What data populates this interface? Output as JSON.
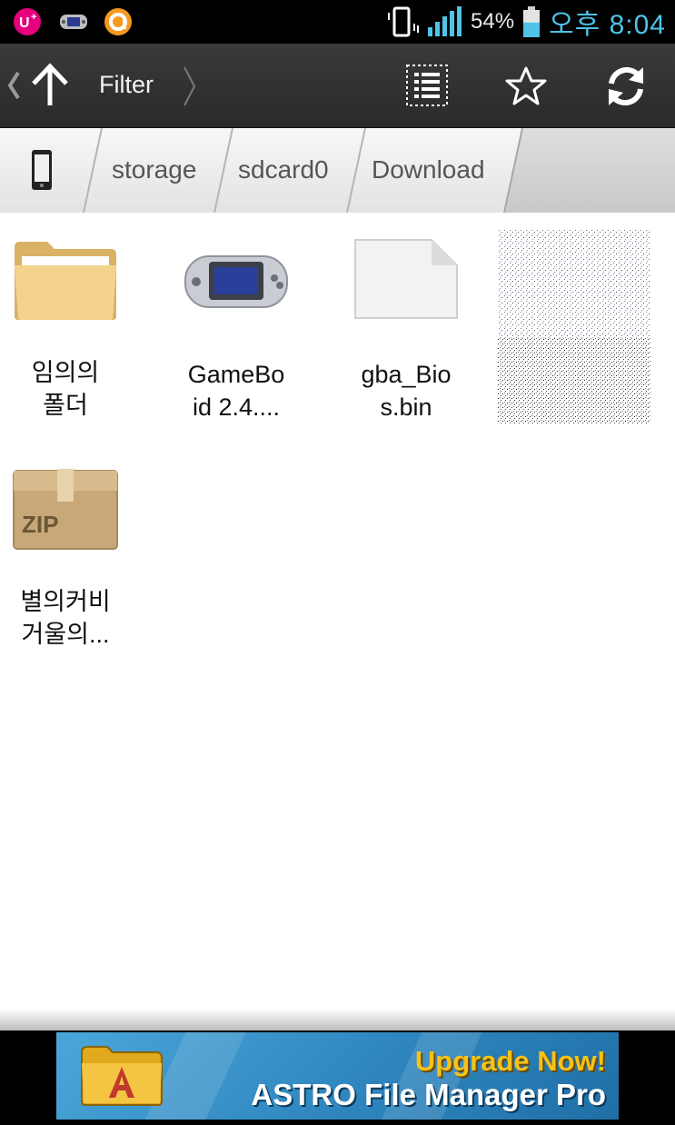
{
  "status_bar": {
    "icons_left": [
      "uplus-icon",
      "gameboy-icon",
      "orange-app-icon"
    ],
    "battery_percent_text": "54%",
    "time": "오후 8:04",
    "battery_level": 0.54,
    "time_color": "#4fc3e8"
  },
  "toolbar": {
    "filter_label": "Filter",
    "icons": [
      "chevron-left-icon",
      "up-arrow-icon",
      "chevron-right-icon",
      "list-view-icon",
      "star-icon",
      "refresh-icon"
    ]
  },
  "breadcrumb": {
    "segments": [
      "storage",
      "sdcard0",
      "Download"
    ]
  },
  "files": [
    {
      "name": "임의의\n폴더",
      "type": "folder"
    },
    {
      "name": "GameBo\nid 2.4....",
      "type": "apk"
    },
    {
      "name": "gba_Bio\ns.bin",
      "type": "file"
    },
    {
      "name": "",
      "type": "image"
    },
    {
      "name": "별의커비\n거울의...",
      "type": "zip"
    }
  ],
  "zip_icon_label": "ZIP",
  "ad": {
    "headline": "Upgrade Now!",
    "product": "ASTRO File Manager Pro",
    "headline_color": "#f6c21a"
  }
}
